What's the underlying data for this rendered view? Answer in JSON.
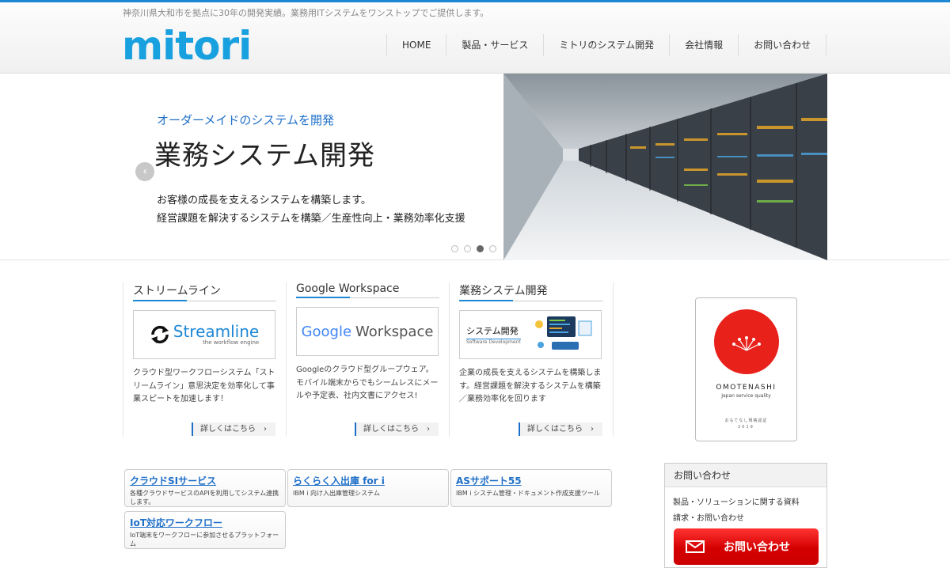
{
  "header": {
    "tagline": "神奈川県大和市を拠点に30年の開発実績。業務用ITシステムをワンストップでご提供します。",
    "logo": "mitori",
    "nav": [
      "HOME",
      "製品・サービス",
      "ミトリのシステム開発",
      "会社情報",
      "お問い合わせ"
    ]
  },
  "hero": {
    "subtitle": "オーダーメイドのシステムを開発",
    "title": "業務システム開発",
    "desc1": "お客様の成長を支えるシステムを構築します。",
    "desc2": "経営課題を解決するシステムを構築／生産性向上・業務効率化支援",
    "prev_icon": "‹",
    "slides": 4,
    "active_slide": 3
  },
  "cards": [
    {
      "title": "ストリームライン",
      "logo_text": "Streamline",
      "logo_sub": "the workflow engine",
      "text": "クラウド型ワークフローシステム「ストリームライン」意思決定を効率化して事業スピートを加速します！",
      "more": "詳しくはこちら　›"
    },
    {
      "title": "Google Workspace",
      "logo_text_google": "Google",
      "logo_text_ws": "Workspace",
      "text": "Googleのクラウド型グループウェア。モバイル端末からでもシームレスにメールや予定表、社内文書にアクセス!",
      "more": "詳しくはこちら　›"
    },
    {
      "title": "業務システム開発",
      "logo_text": "システム開発",
      "logo_sub": "Software Development",
      "text": "企業の成長を支えるシステムを構築します。経営課題を解決するシステムを構築／業務効率化を回ります",
      "more": "詳しくはこちら　›"
    }
  ],
  "badge": {
    "title": "OMOTENASHI",
    "subtitle": "Japan service quality",
    "cert": "おもてなし規格認証",
    "year": "2019"
  },
  "links": [
    {
      "title": "クラウドSIサービス",
      "desc": "各種クラウドサービスのAPIを利用してシステム連携します。"
    },
    {
      "title": "らくらく入出庫 for i",
      "desc": "IBM i 向け入出庫管理システム"
    },
    {
      "title": "ASサポート55",
      "desc": "IBM i システム管理・ドキュメント作成支援ツール"
    },
    {
      "title": "IoT対応ワークフロー",
      "desc": "IoT端末をワークフローに参加させるプラットフォーム"
    }
  ],
  "contact": {
    "heading": "お問い合わせ",
    "line1": "製品・ソリューションに関する資料",
    "line2": "請求・お問い合わせ",
    "button": "お問い合わせ"
  },
  "colors": {
    "accent": "#1e88d6",
    "logo": "#18a0df",
    "button": "#d40000"
  }
}
